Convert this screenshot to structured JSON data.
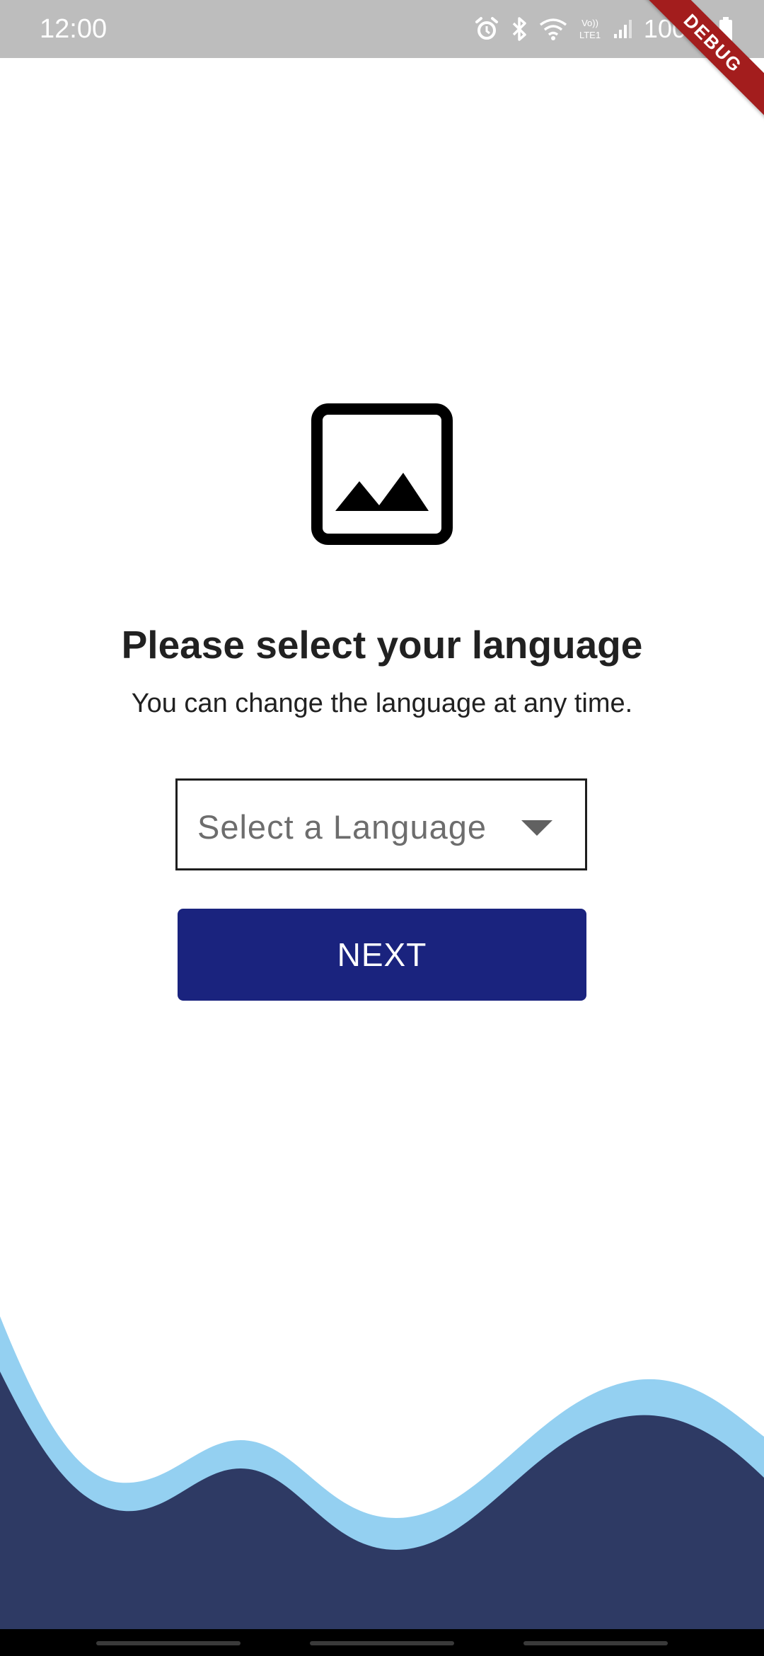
{
  "status_bar": {
    "time": "12:00",
    "battery_percent": "100%",
    "icons": [
      "alarm-icon",
      "bluetooth-icon",
      "wifi-icon",
      "volte-icon",
      "signal-icon",
      "battery-icon"
    ]
  },
  "debug_banner": {
    "label": "DEBUG"
  },
  "main": {
    "image_icon": "image-placeholder-icon",
    "title": "Please select your language",
    "subtitle": "You can change the language at any time.",
    "language_select": {
      "placeholder": "Select a Language",
      "caret_icon": "dropdown-caret-icon"
    },
    "next_button": {
      "label": "NEXT"
    }
  },
  "colors": {
    "primary": "#1a237e",
    "wave_light": "#94d0f1",
    "wave_dark": "#2e3a64",
    "status_bar": "#bdbdbd",
    "debug_ribbon": "#a31d1d"
  }
}
